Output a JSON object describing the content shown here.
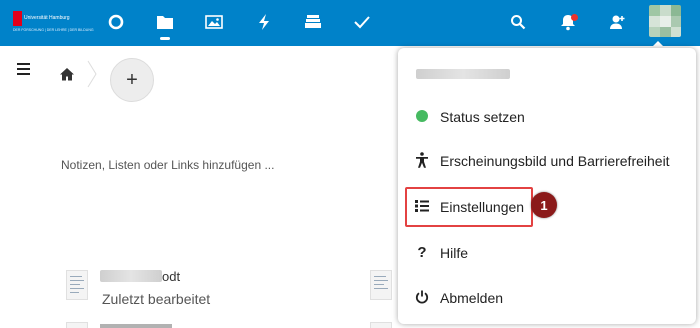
{
  "header": {
    "logo": {
      "name": "Universität Hamburg",
      "subtitle": "DER FORSCHUNG | DER LEHRE | DER BILDUNG"
    },
    "apps": [
      {
        "name": "dashboard",
        "icon": "circle-icon"
      },
      {
        "name": "files",
        "icon": "folder-icon",
        "active": true
      },
      {
        "name": "photos",
        "icon": "image-icon"
      },
      {
        "name": "activity",
        "icon": "lightning-icon"
      },
      {
        "name": "deck",
        "icon": "stack-icon"
      },
      {
        "name": "tasks",
        "icon": "checkmark-icon"
      }
    ],
    "right_icons": [
      "search-icon",
      "notifications-icon",
      "contacts-icon",
      "avatar"
    ],
    "accent_color": "#0082c9",
    "notification_color": "#e9322d"
  },
  "main": {
    "breadcrumb_home_icon": "home-icon",
    "add_button_label": "+",
    "placeholder": "Notizen, Listen oder Links hinzufügen ...",
    "recent_files": [
      {
        "name_suffix": "odt",
        "subtitle": "Zuletzt bearbeitet"
      }
    ]
  },
  "user_menu": {
    "items": [
      {
        "label": "Status setzen",
        "icon": "status-dot-icon"
      },
      {
        "label": "Erscheinungsbild und Barrierefreiheit",
        "icon": "accessibility-icon"
      },
      {
        "label": "Einstellungen",
        "icon": "settings-list-icon",
        "highlighted": true
      },
      {
        "label": "Hilfe",
        "icon": "help-icon"
      },
      {
        "label": "Abmelden",
        "icon": "power-icon"
      }
    ],
    "status_color": "#46ba61"
  },
  "annotation": {
    "step_number": "1",
    "color": "#8b1a1a"
  }
}
